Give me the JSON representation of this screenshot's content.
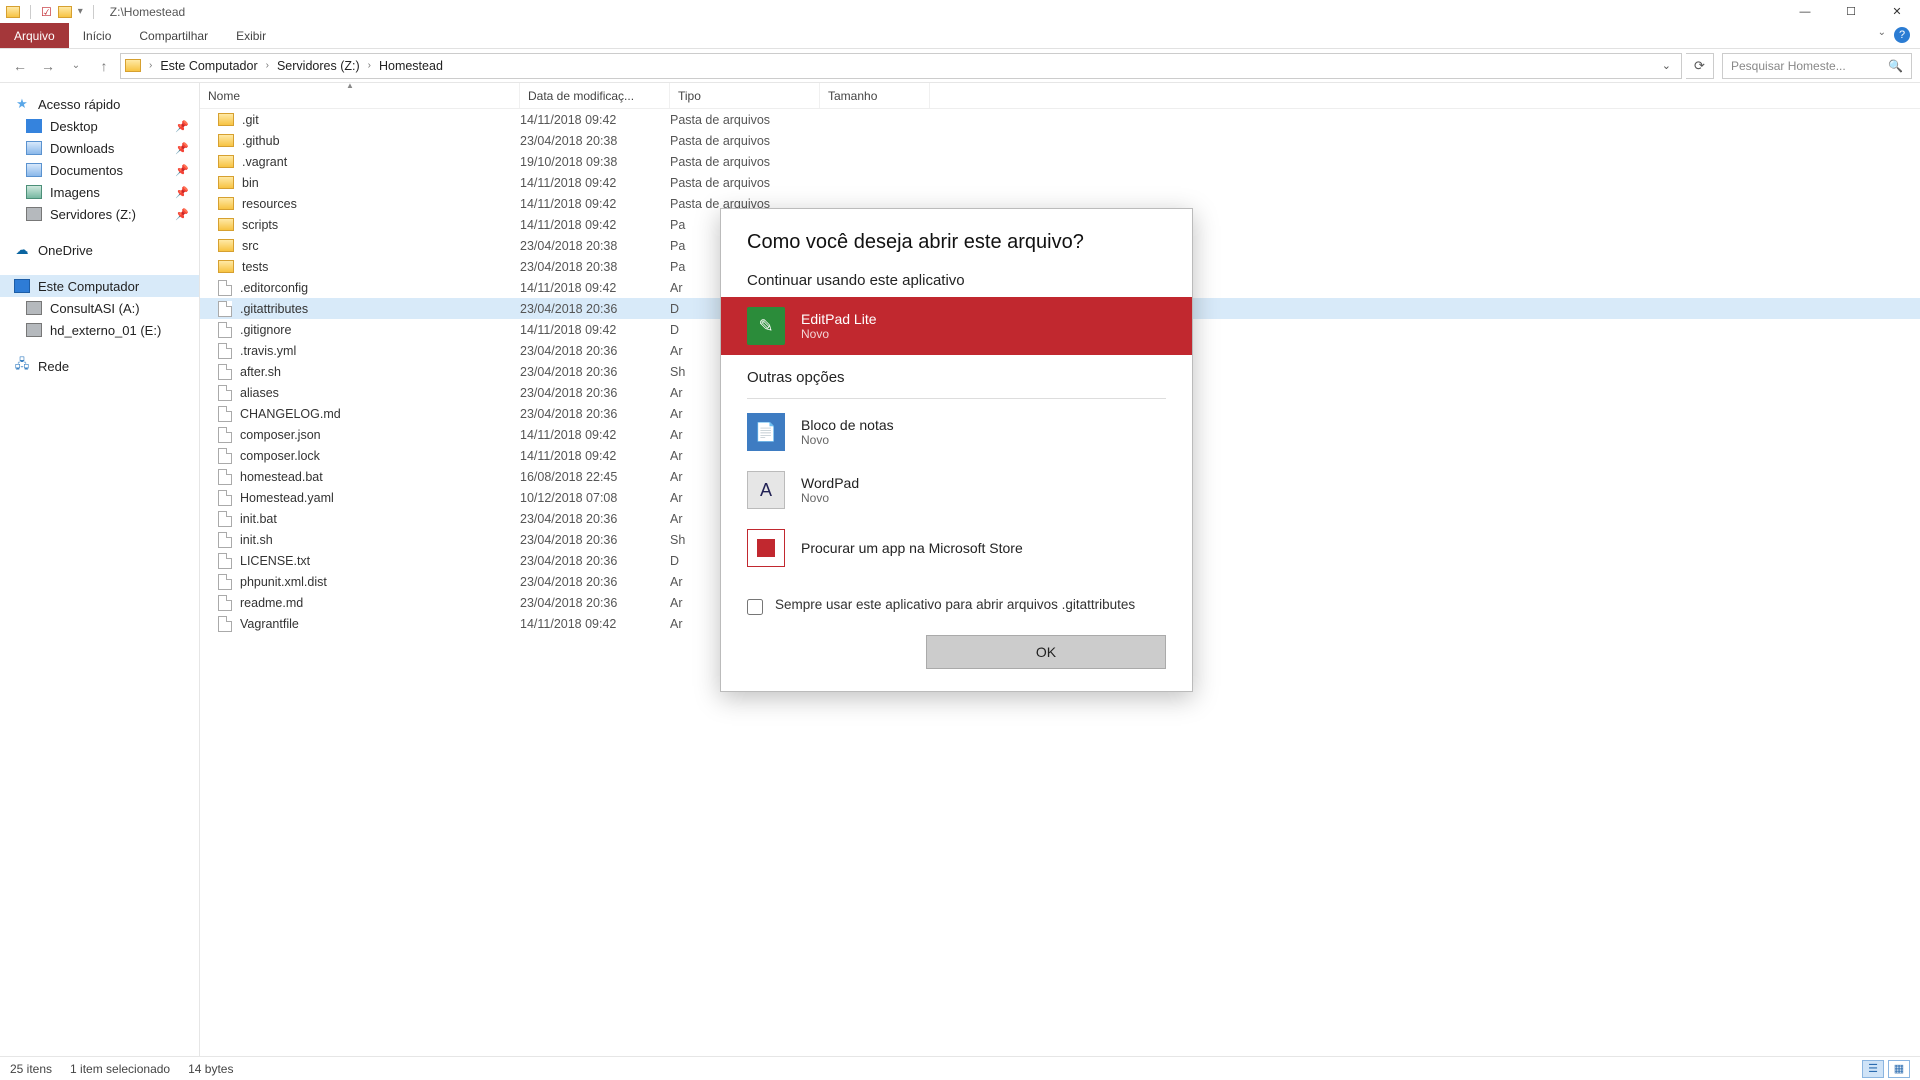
{
  "title": "Z:\\Homestead",
  "ribbon": {
    "file": "Arquivo",
    "home": "Início",
    "share": "Compartilhar",
    "view": "Exibir"
  },
  "breadcrumb": [
    "Este Computador",
    "Servidores (Z:)",
    "Homestead"
  ],
  "search_placeholder": "Pesquisar Homeste...",
  "columns": {
    "name": "Nome",
    "date": "Data de modificaç...",
    "type": "Tipo",
    "size": "Tamanho"
  },
  "sidebar": {
    "quick": "Acesso rápido",
    "quick_items": [
      "Desktop",
      "Downloads",
      "Documentos",
      "Imagens",
      "Servidores (Z:)"
    ],
    "onedrive": "OneDrive",
    "thispc": "Este Computador",
    "drives": [
      "ConsultASI (A:)",
      "hd_externo_01 (E:)"
    ],
    "network": "Rede"
  },
  "files": [
    {
      "n": ".git",
      "d": "14/11/2018 09:42",
      "t": "Pasta de arquivos",
      "folder": true
    },
    {
      "n": ".github",
      "d": "23/04/2018 20:38",
      "t": "Pasta de arquivos",
      "folder": true
    },
    {
      "n": ".vagrant",
      "d": "19/10/2018 09:38",
      "t": "Pasta de arquivos",
      "folder": true
    },
    {
      "n": "bin",
      "d": "14/11/2018 09:42",
      "t": "Pasta de arquivos",
      "folder": true
    },
    {
      "n": "resources",
      "d": "14/11/2018 09:42",
      "t": "Pasta de arquivos",
      "folder": true
    },
    {
      "n": "scripts",
      "d": "14/11/2018 09:42",
      "t": "Pa",
      "folder": true
    },
    {
      "n": "src",
      "d": "23/04/2018 20:38",
      "t": "Pa",
      "folder": true
    },
    {
      "n": "tests",
      "d": "23/04/2018 20:38",
      "t": "Pa",
      "folder": true
    },
    {
      "n": ".editorconfig",
      "d": "14/11/2018 09:42",
      "t": "Ar",
      "folder": false
    },
    {
      "n": ".gitattributes",
      "d": "23/04/2018 20:36",
      "t": "D",
      "folder": false,
      "selected": true
    },
    {
      "n": ".gitignore",
      "d": "14/11/2018 09:42",
      "t": "D",
      "folder": false
    },
    {
      "n": ".travis.yml",
      "d": "23/04/2018 20:36",
      "t": "Ar",
      "folder": false
    },
    {
      "n": "after.sh",
      "d": "23/04/2018 20:36",
      "t": "Sh",
      "folder": false
    },
    {
      "n": "aliases",
      "d": "23/04/2018 20:36",
      "t": "Ar",
      "folder": false
    },
    {
      "n": "CHANGELOG.md",
      "d": "23/04/2018 20:36",
      "t": "Ar",
      "folder": false
    },
    {
      "n": "composer.json",
      "d": "14/11/2018 09:42",
      "t": "Ar",
      "folder": false
    },
    {
      "n": "composer.lock",
      "d": "14/11/2018 09:42",
      "t": "Ar",
      "folder": false
    },
    {
      "n": "homestead.bat",
      "d": "16/08/2018 22:45",
      "t": "Ar",
      "folder": false
    },
    {
      "n": "Homestead.yaml",
      "d": "10/12/2018 07:08",
      "t": "Ar",
      "folder": false
    },
    {
      "n": "init.bat",
      "d": "23/04/2018 20:36",
      "t": "Ar",
      "folder": false
    },
    {
      "n": "init.sh",
      "d": "23/04/2018 20:36",
      "t": "Sh",
      "folder": false
    },
    {
      "n": "LICENSE.txt",
      "d": "23/04/2018 20:36",
      "t": "D",
      "folder": false
    },
    {
      "n": "phpunit.xml.dist",
      "d": "23/04/2018 20:36",
      "t": "Ar",
      "folder": false
    },
    {
      "n": "readme.md",
      "d": "23/04/2018 20:36",
      "t": "Ar",
      "folder": false
    },
    {
      "n": "Vagrantfile",
      "d": "14/11/2018 09:42",
      "t": "Ar",
      "folder": false
    }
  ],
  "status": {
    "count": "25 itens",
    "selected": "1 item selecionado",
    "size": "14 bytes"
  },
  "dialog": {
    "title": "Como você deseja abrir este arquivo?",
    "continue": "Continuar usando este aplicativo",
    "other": "Outras opções",
    "apps": {
      "editpad": {
        "name": "EditPad Lite",
        "sub": "Novo"
      },
      "notepad": {
        "name": "Bloco de notas",
        "sub": "Novo"
      },
      "wordpad": {
        "name": "WordPad",
        "sub": "Novo"
      },
      "store": {
        "name": "Procurar um app na Microsoft Store"
      }
    },
    "always": "Sempre usar este aplicativo para abrir arquivos .gitattributes",
    "ok": "OK"
  }
}
